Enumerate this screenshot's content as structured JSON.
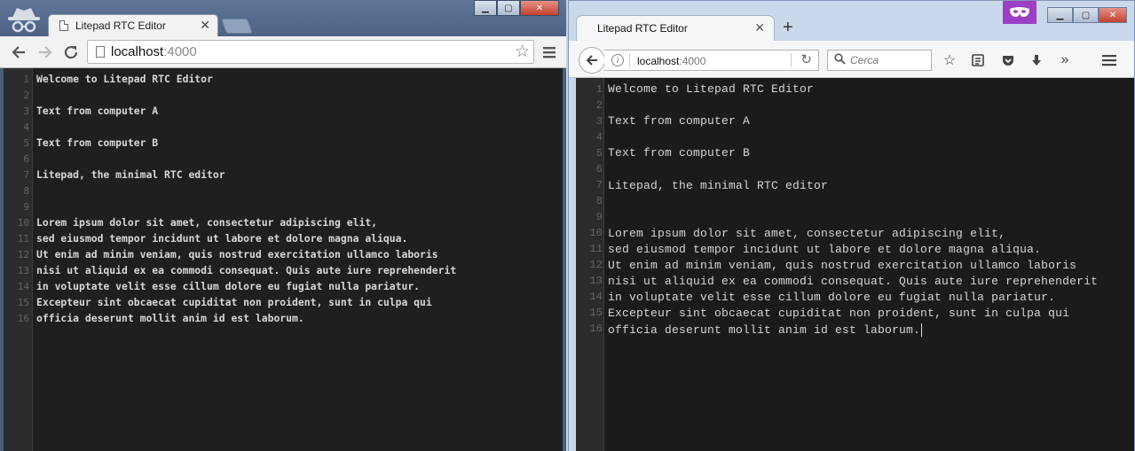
{
  "left_window": {
    "tab_title": "Litepad RTC Editor",
    "tab_close": "✕",
    "url_host": "localhost",
    "url_port": ":4000"
  },
  "right_window": {
    "tab_title": "Litepad RTC Editor",
    "tab_close": "✕",
    "new_tab": "+",
    "url_host": "localhost",
    "url_port": ":4000",
    "search_placeholder": "Cerca"
  },
  "window_buttons": {
    "minimize": "▁",
    "maximize": "▢",
    "close": "✕"
  },
  "editor": {
    "line_numbers": [
      "1",
      "2",
      "3",
      "4",
      "5",
      "6",
      "7",
      "8",
      "9",
      "10",
      "11",
      "12",
      "13",
      "14",
      "15",
      "16"
    ],
    "lines": [
      "Welcome to Litepad RTC Editor",
      "",
      "Text from computer A",
      "",
      "Text from computer B",
      "",
      "Litepad, the minimal RTC editor",
      "",
      "",
      "Lorem ipsum dolor sit amet, consectetur adipiscing elit,",
      "sed eiusmod tempor incidunt ut labore et dolore magna aliqua.",
      "Ut enim ad minim veniam, quis nostrud exercitation ullamco laboris",
      "nisi ut aliquid ex ea commodi consequat. Quis aute iure reprehenderit",
      "in voluptate velit esse cillum dolore eu fugiat nulla pariatur.",
      "Excepteur sint obcaecat cupiditat non proident, sunt in culpa qui",
      "officia deserunt mollit anim id est laborum."
    ]
  },
  "colors": {
    "editor_bg": "#1d1f21",
    "gutter_bg": "#2a2c2e",
    "line_number": "#5f6366",
    "text": "#d8d8d8",
    "private_browsing": "#9b3fc4"
  }
}
